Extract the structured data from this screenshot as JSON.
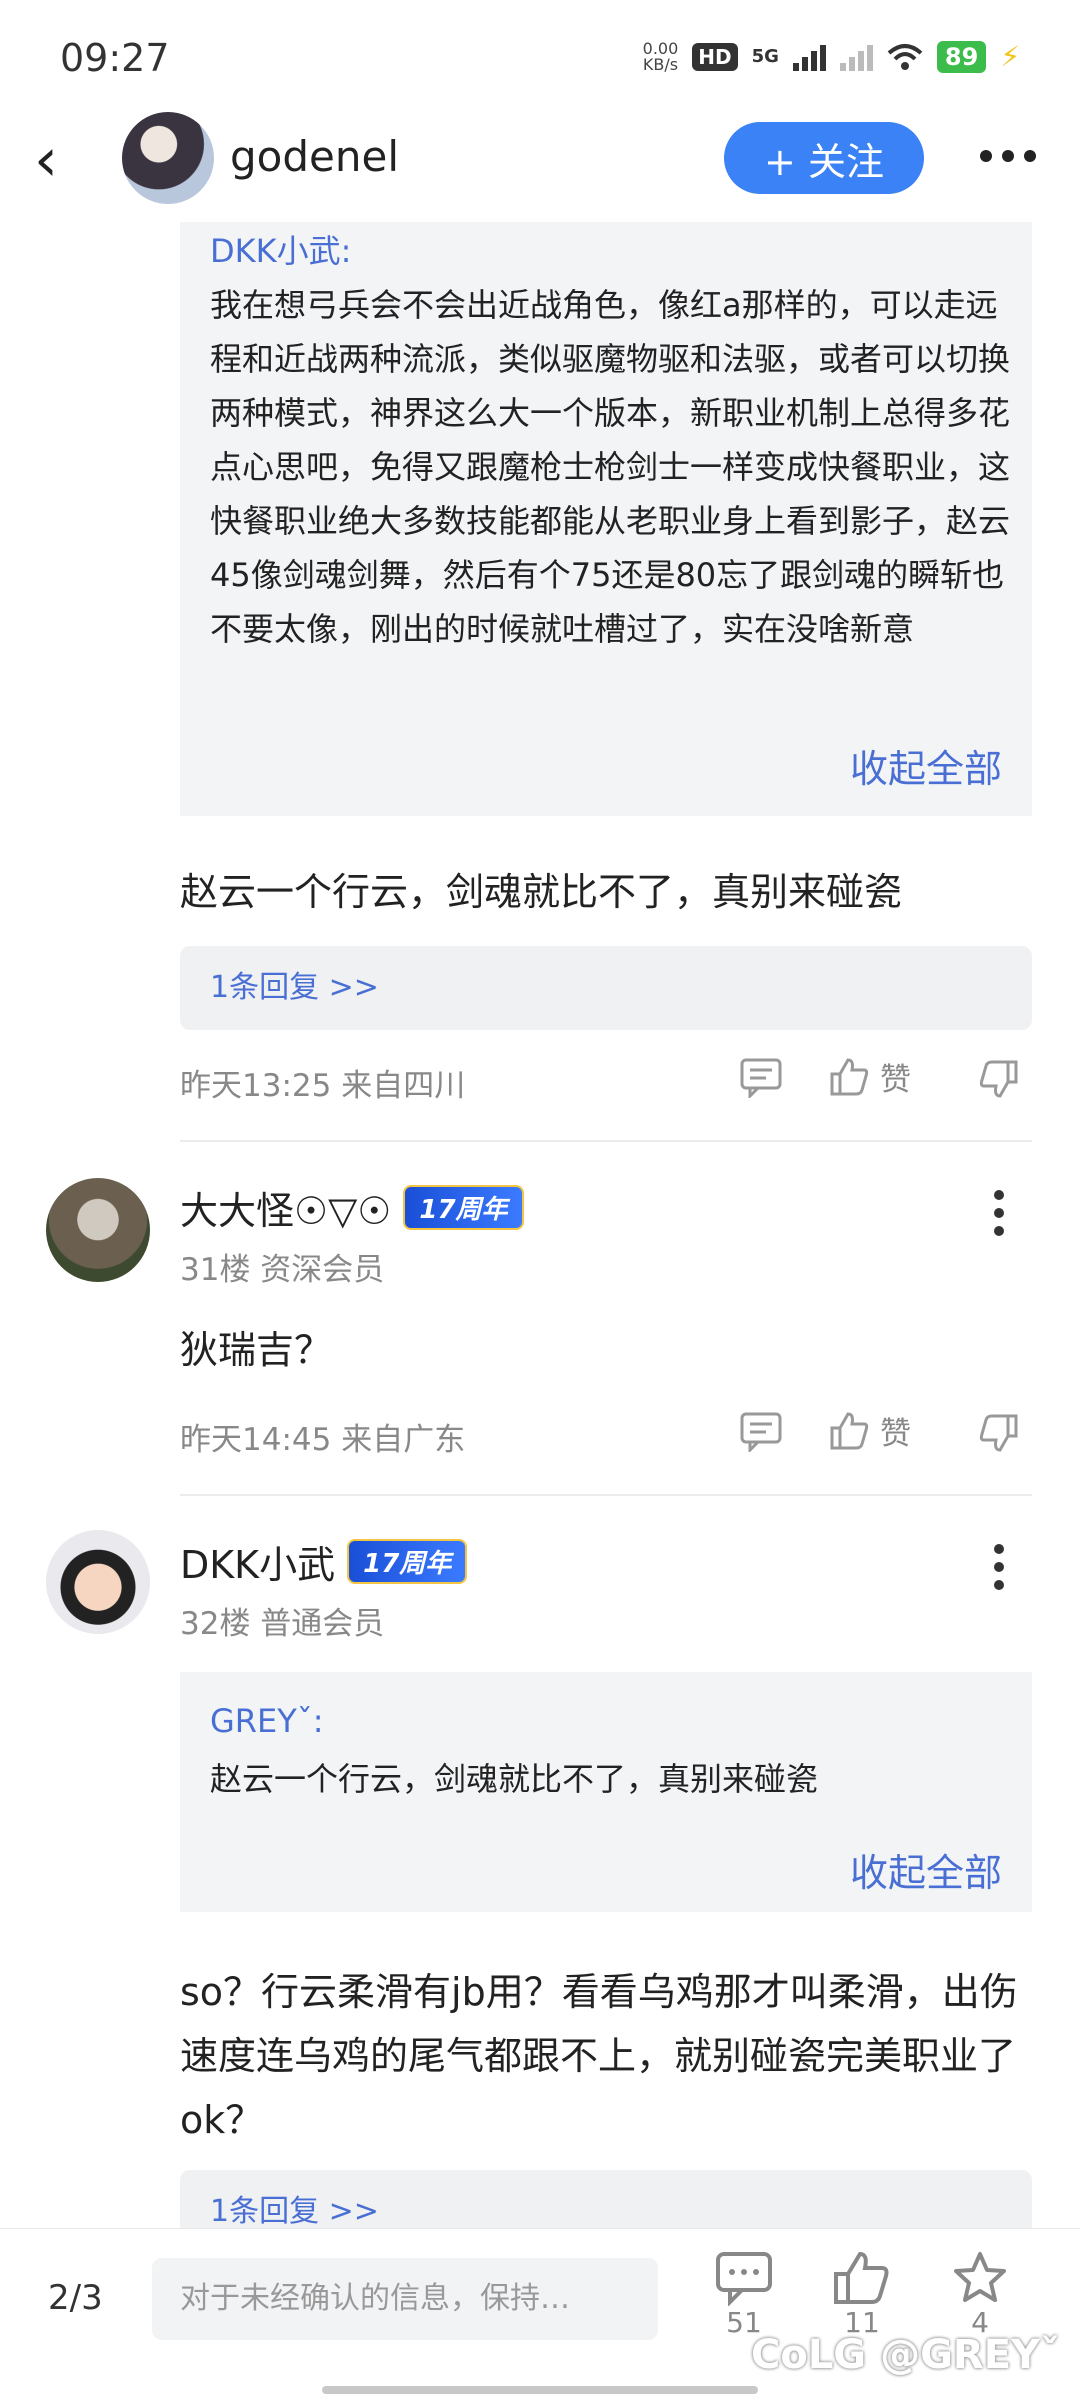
{
  "status": {
    "time": "09:27",
    "net_speed": "0.00",
    "net_unit": "KB/s",
    "hd": "HD",
    "network": "5G",
    "battery": "89"
  },
  "header": {
    "title": "godenel",
    "follow_label": "+ 关注"
  },
  "quote1": {
    "author": "DKK小武:",
    "text": "我在想弓兵会不会出近战角色，像红a那样的，可以走远程和近战两种流派，类似驱魔物驱和法驱，或者可以切换两种模式，神界这么大一个版本，新职业机制上总得多花点心思吧，免得又跟魔枪士枪剑士一样变成快餐职业，这快餐职业绝大多数技能都能从老职业身上看到影子，赵云45像剑魂剑舞，然后有个75还是80忘了跟剑魂的瞬斩也不要太像，刚出的时候就吐槽过了，实在没啥新意",
    "collapse": "收起全部"
  },
  "post1": {
    "text": "赵云一个行云，剑魂就比不了，真别来碰瓷",
    "reply": "1条回复 >>",
    "meta": "昨天13:25 来自四川",
    "like": "赞"
  },
  "post2": {
    "user": "大大怪☉▽☉",
    "badge": "17周年",
    "floor": "31楼 资深会员",
    "text": "狄瑞吉？",
    "meta": "昨天14:45 来自广东",
    "like": "赞"
  },
  "post3": {
    "user": "DKK小武",
    "badge": "17周年",
    "floor": "32楼 普通会员",
    "quote_author": "GREYˇ:",
    "quote_text": "赵云一个行云，剑魂就比不了，真别来碰瓷",
    "collapse": "收起全部",
    "text": "so？行云柔滑有jb用？看看乌鸡那才叫柔滑，出伤速度连乌鸡的尾气都跟不上，就别碰瓷完美职业了ok？",
    "reply": "1条回复 >>"
  },
  "bottom": {
    "page": "2/3",
    "input_placeholder": "对于未经确认的信息，保持…",
    "comments": "51",
    "likes": "11",
    "favorites": "4",
    "watermark": "CoLG @GREYˇ"
  },
  "icons": [
    "back-icon",
    "more-icon",
    "comment-icon",
    "like-icon",
    "dislike-icon",
    "star-icon"
  ],
  "colors": {
    "accent": "#3b82f6",
    "link": "#4a6fd4"
  }
}
